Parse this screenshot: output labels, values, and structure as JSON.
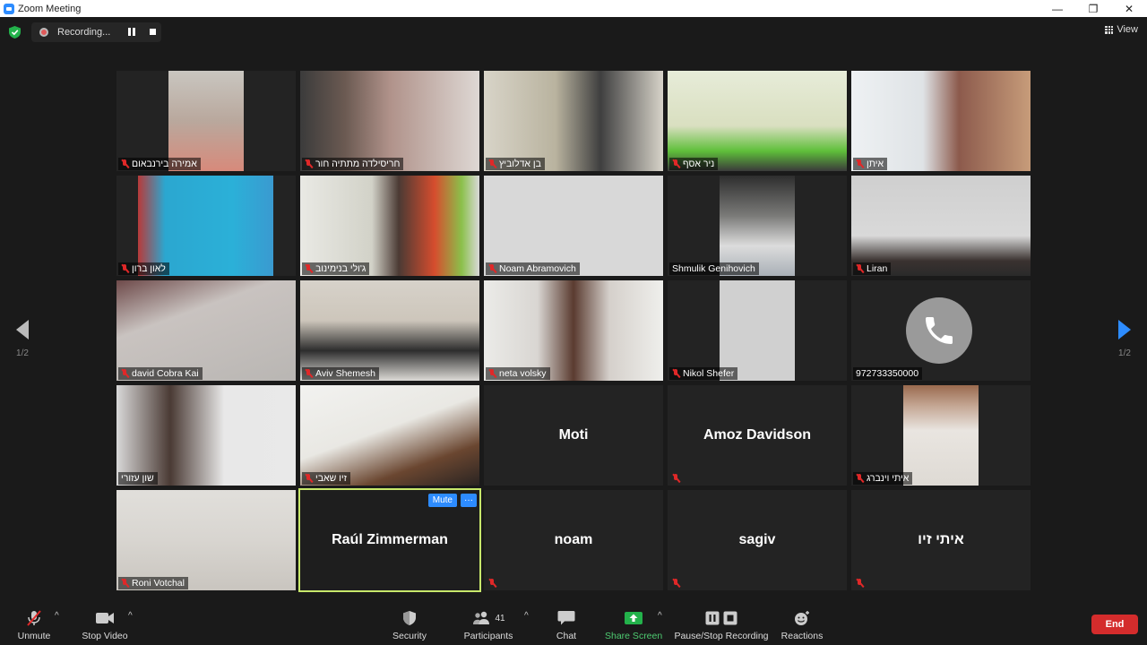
{
  "window": {
    "title": "Zoom Meeting",
    "minimize": "—",
    "restore": "❐",
    "close": "✕"
  },
  "topbar": {
    "recording_label": "Recording...",
    "view_label": "View"
  },
  "pagination": {
    "left": "1/2",
    "right": "1/2"
  },
  "participants": [
    {
      "name": "אמירה בירנבאום",
      "muted": true,
      "video": true
    },
    {
      "name": "חריסילדה מתתיה חור",
      "muted": true,
      "video": true
    },
    {
      "name": "בן אדלוביץ",
      "muted": true,
      "video": true
    },
    {
      "name": "ניר אסף",
      "muted": true,
      "video": true
    },
    {
      "name": "איתן",
      "muted": true,
      "video": true
    },
    {
      "name": "לאון ברון",
      "muted": true,
      "video": true
    },
    {
      "name": "ג'ולי בנימינוב",
      "muted": true,
      "video": true
    },
    {
      "name": "Noam Abramovich",
      "muted": true,
      "video": true
    },
    {
      "name": "Shmulik Genihovich",
      "muted": false,
      "video": true
    },
    {
      "name": "Liran",
      "muted": true,
      "video": true
    },
    {
      "name": "david Cobra Kai",
      "muted": true,
      "video": true
    },
    {
      "name": "Aviv Shemesh",
      "muted": true,
      "video": true
    },
    {
      "name": "neta volsky",
      "muted": true,
      "video": true
    },
    {
      "name": "Nikol Shefer",
      "muted": true,
      "video": true
    },
    {
      "name": "972733350000",
      "muted": false,
      "video": false,
      "phone": true
    },
    {
      "name": "שון עזורי",
      "muted": false,
      "video": true
    },
    {
      "name": "זיו שאבי",
      "muted": true,
      "video": true
    },
    {
      "name": "Moti",
      "muted": false,
      "video": false
    },
    {
      "name": "Amoz Davidson",
      "muted": true,
      "video": false
    },
    {
      "name": "איתי וינברג",
      "muted": true,
      "video": true
    },
    {
      "name": "Roni Votchal",
      "muted": true,
      "video": true
    },
    {
      "name": "Raúl Zimmerman",
      "muted": false,
      "video": false,
      "active": true
    },
    {
      "name": "noam",
      "muted": true,
      "video": false
    },
    {
      "name": "sagiv",
      "muted": true,
      "video": false
    },
    {
      "name": "איתי זיו",
      "muted": true,
      "video": false
    }
  ],
  "active_tile": {
    "mute_label": "Mute",
    "more_label": "···"
  },
  "toolbar": {
    "unmute": "Unmute",
    "stop_video": "Stop Video",
    "security": "Security",
    "participants": "Participants",
    "participants_count": "41",
    "chat": "Chat",
    "share_screen": "Share Screen",
    "pause_recording": "Pause/Stop Recording",
    "reactions": "Reactions",
    "end": "End"
  },
  "colors": {
    "accent": "#2d8cff",
    "active_border": "#c8e86b",
    "end": "#d42c2c",
    "share": "#4ecb71",
    "muted": "#e02828"
  }
}
